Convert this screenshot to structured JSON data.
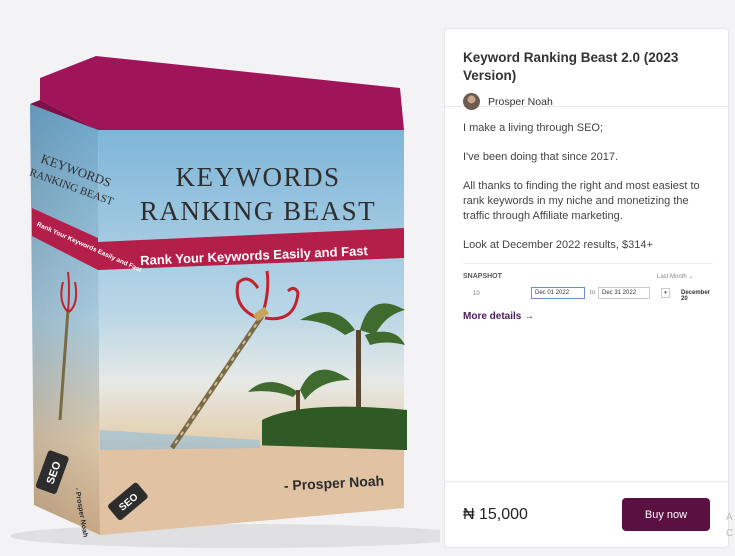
{
  "product": {
    "title": "Keyword Ranking Beast 2.0 (2023 Version)",
    "author": "Prosper Noah",
    "description": [
      "I make a living through SEO;",
      "I've been doing that since 2017.",
      "All thanks to finding the right and most easiest to rank keywords in my niche and monetizing the traffic through Affiliate marketing.",
      "Look at December 2022 results, $314+"
    ],
    "more_label": "More details →",
    "price": "₦ 15,000",
    "buy_label": "Buy now"
  },
  "snapshot": {
    "label": "SNAPSHOT",
    "range": "Last Month ⌄",
    "num": "10",
    "start": "Dec 01 2022",
    "to": "to",
    "end": "Dec 31 2022",
    "arrow": "▾",
    "display": "December 20"
  },
  "cover": {
    "title_line1": "KEYWORDS",
    "title_line2": "RANKING BEAST",
    "tagline": "Rank Your Keywords Easily and Fast",
    "author_credit": "- Prosper Noah",
    "side_title_line1": "KEYWORDS",
    "side_title_line2": "RANKING BEAST",
    "side_tagline": "Rank Your Keywords Easily and Fast",
    "side_credit": "- Prosper Noah",
    "seo_tag": "SEO"
  },
  "edge_fragment": "A C",
  "colors": {
    "accent": "#5b1042",
    "lid": "#a0155a",
    "banner": "#b41f4a"
  }
}
